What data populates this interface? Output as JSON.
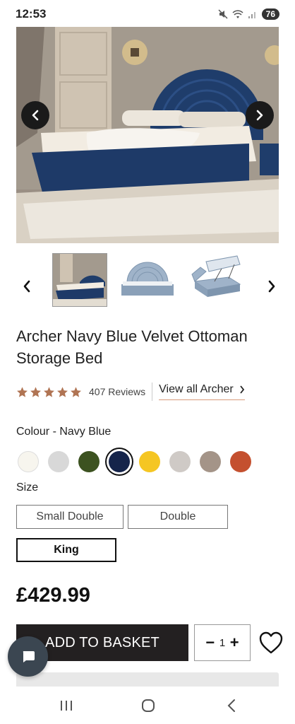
{
  "status_bar": {
    "time": "12:53",
    "battery": "76"
  },
  "hero": {
    "prev_icon": "chevron-left-icon",
    "next_icon": "chevron-right-icon"
  },
  "thumbnails": [
    "bed-photo",
    "bed-diagram",
    "ottoman-lift-diagram"
  ],
  "product": {
    "title": "Archer Navy Blue Velvet Ottoman Storage Bed",
    "rating": 5,
    "reviews_label": "407 Reviews",
    "view_all_label": "View all Archer"
  },
  "colour": {
    "label": "Colour - Navy Blue",
    "selected_index": 3,
    "swatches": [
      "#f7f5ee",
      "#d8d8d8",
      "#3c5220",
      "#15244a",
      "#f5c623",
      "#cfcac6",
      "#a49488",
      "#c4502f"
    ]
  },
  "size": {
    "label": "Size",
    "options": [
      "Small Double",
      "Double",
      "King"
    ],
    "selected": "King"
  },
  "price": "£429.99",
  "basket": {
    "add_label": "ADD TO BASKET",
    "quantity": "1",
    "minus": "−",
    "plus": "+"
  },
  "colors": {
    "accent_underline": "#d89a7a",
    "star": "#b07453",
    "button_dark": "#232021"
  }
}
